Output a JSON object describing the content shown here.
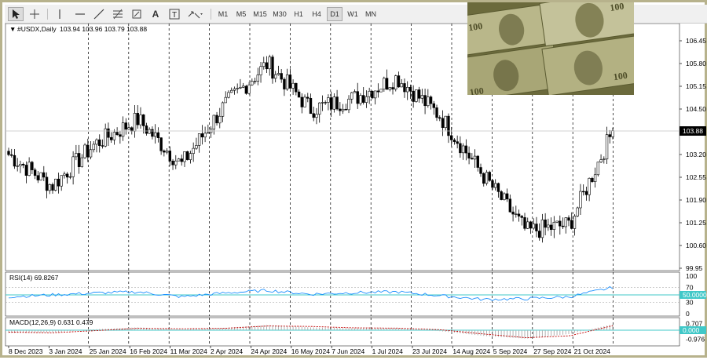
{
  "toolbar": {
    "timeframes": [
      "M1",
      "M5",
      "M15",
      "M30",
      "H1",
      "H4",
      "D1",
      "W1",
      "MN"
    ],
    "active_timeframe": "D1"
  },
  "main_panel": {
    "symbol_label": "#USDX,Daily",
    "ohlc_label": "103.94 103.96 103.79 103.88",
    "current_price_label": "103.88",
    "y_ticks": [
      "106.45",
      "105.80",
      "105.15",
      "104.50",
      "103.88",
      "103.20",
      "102.55",
      "101.90",
      "101.25",
      "100.60",
      "99.95"
    ]
  },
  "rsi_panel": {
    "label": "RSI(14) 69.8267",
    "ticks": [
      "100",
      "70",
      "50.0000",
      "30",
      "0"
    ]
  },
  "macd_panel": {
    "label": "MACD(12,26,9) 0.631 0.479",
    "ticks": [
      "0.707",
      "0.000",
      "-0.976"
    ]
  },
  "x_axis": {
    "labels": [
      "8 Dec 2023",
      "3 Jan 2024",
      "25 Jan 2024",
      "16 Feb 2024",
      "11 Mar 2024",
      "2 Apr 2024",
      "24 Apr 2024",
      "16 May 2024",
      "7 Jun 2024",
      "1 Jul 2024",
      "23 Jul 2024",
      "14 Aug 2024",
      "5 Sep 2024",
      "27 Sep 2024",
      "21 Oct 2024"
    ]
  },
  "colors": {
    "rsi_line": "#1e90ff",
    "rsi_level": "#40c8c8",
    "macd_signal": "#c00000",
    "macd_hist": "#b0b0b0",
    "frame": "#b7b28c"
  },
  "chart_data": {
    "type": "candlestick",
    "title": "#USDX,Daily",
    "ylim": [
      99.95,
      106.45
    ],
    "x": [
      "8 Dec 2023",
      "3 Jan 2024",
      "25 Jan 2024",
      "16 Feb 2024",
      "11 Mar 2024",
      "2 Apr 2024",
      "24 Apr 2024",
      "16 May 2024",
      "7 Jun 2024",
      "1 Jul 2024",
      "23 Jul 2024",
      "14 Aug 2024",
      "5 Sep 2024",
      "27 Sep 2024",
      "21 Oct 2024"
    ],
    "close": [
      103.2,
      102.3,
      103.5,
      104.2,
      102.9,
      104.6,
      105.8,
      104.5,
      104.8,
      105.4,
      104.3,
      102.6,
      101.0,
      101.2,
      103.88
    ],
    "rsi": [
      45,
      50,
      55,
      58,
      45,
      55,
      62,
      52,
      56,
      58,
      48,
      38,
      40,
      45,
      69.8267
    ],
    "macd": [
      -0.3,
      -0.25,
      0.1,
      0.3,
      0.05,
      0.25,
      0.55,
      0.3,
      0.2,
      0.25,
      -0.1,
      -0.6,
      -0.9,
      -0.4,
      0.631
    ],
    "macd_signal": [
      -0.2,
      -0.28,
      -0.05,
      0.2,
      0.15,
      0.2,
      0.45,
      0.4,
      0.25,
      0.22,
      0.05,
      -0.4,
      -0.8,
      -0.6,
      0.479
    ]
  }
}
